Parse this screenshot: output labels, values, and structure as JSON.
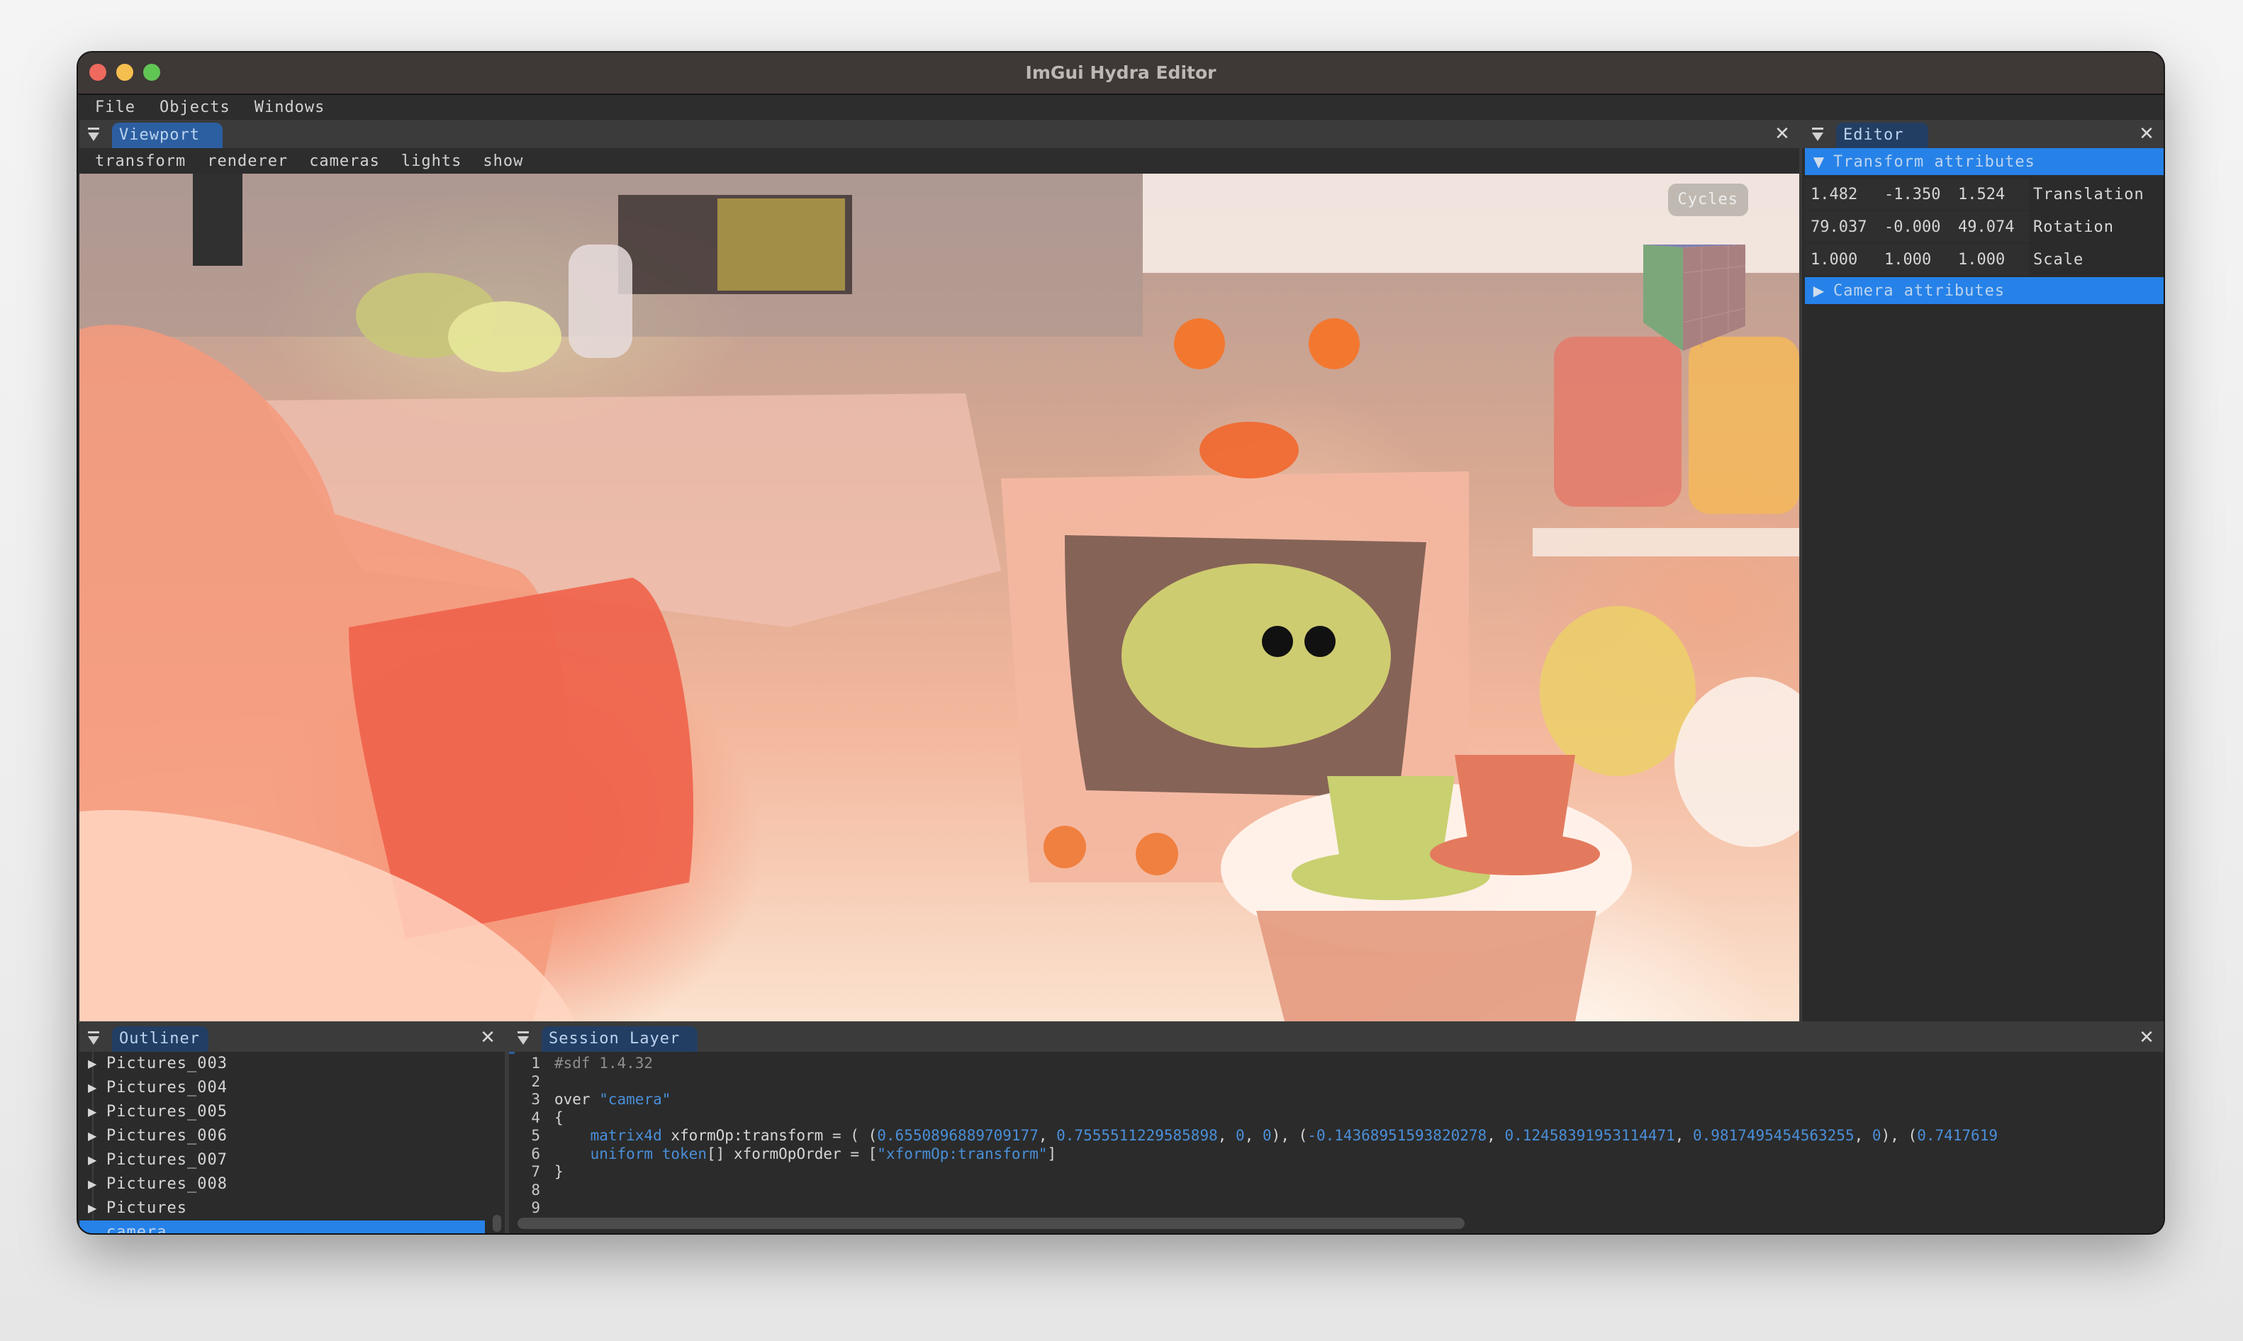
{
  "window": {
    "title": "ImGui Hydra Editor",
    "traffic_lights": [
      {
        "name": "close",
        "color": "#ee6a5e"
      },
      {
        "name": "minimize",
        "color": "#f5bf4f"
      },
      {
        "name": "zoom",
        "color": "#61c554"
      }
    ]
  },
  "menubar": {
    "items": [
      "File",
      "Objects",
      "Windows"
    ]
  },
  "viewport": {
    "tab_label": "Viewport",
    "toolbar": [
      "transform",
      "renderer",
      "cameras",
      "lights",
      "show"
    ],
    "renderer_badge": "Cycles"
  },
  "editor": {
    "tab_label": "Editor",
    "transform_section": {
      "label": "Transform attributes",
      "expanded": true,
      "rows": [
        {
          "label": "Translation",
          "values": [
            "1.482",
            "-1.350",
            "1.524"
          ]
        },
        {
          "label": "Rotation",
          "values": [
            "79.037",
            "-0.000",
            "49.074"
          ]
        },
        {
          "label": "Scale",
          "values": [
            "1.000",
            "1.000",
            "1.000"
          ]
        }
      ]
    },
    "camera_section": {
      "label": "Camera attributes",
      "expanded": false
    }
  },
  "outliner": {
    "tab_label": "Outliner",
    "items": [
      {
        "label": "Pictures_003",
        "has_children": true,
        "selected": false
      },
      {
        "label": "Pictures_004",
        "has_children": true,
        "selected": false
      },
      {
        "label": "Pictures_005",
        "has_children": true,
        "selected": false
      },
      {
        "label": "Pictures_006",
        "has_children": true,
        "selected": false
      },
      {
        "label": "Pictures_007",
        "has_children": true,
        "selected": false
      },
      {
        "label": "Pictures_008",
        "has_children": true,
        "selected": false
      },
      {
        "label": "Pictures",
        "has_children": true,
        "selected": false
      },
      {
        "label": "camera",
        "has_children": false,
        "selected": true
      }
    ]
  },
  "session_layer": {
    "tab_label": "Session Layer",
    "lines": [
      {
        "n": "1",
        "text": "#sdf 1.4.32"
      },
      {
        "n": "2",
        "text": ""
      },
      {
        "n": "3",
        "text": "over \"camera\""
      },
      {
        "n": "4",
        "text": "{"
      },
      {
        "n": "5",
        "text": "    matrix4d xformOp:transform = ( (0.6550896889709177, 0.7555511229585898, 0, 0), (-0.14368951593820278, 0.12458391953114471, 0.9817495454563255, 0), (0.7417619"
      },
      {
        "n": "6",
        "text": "    uniform token[] xformOpOrder = [\"xformOp:transform\"]"
      },
      {
        "n": "7",
        "text": "}"
      },
      {
        "n": "8",
        "text": ""
      },
      {
        "n": "9",
        "text": ""
      }
    ]
  },
  "colors": {
    "accent": "#2682e8",
    "tab_active": "#2c5fa1",
    "tab_inactive": "#233e63",
    "panel_bg": "#2b2b2b",
    "syntax_blue": "#4a8fd9"
  }
}
